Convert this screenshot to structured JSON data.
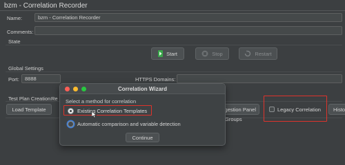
{
  "window": {
    "title": "bzm - Correlation Recorder"
  },
  "form": {
    "name_label": "Name:",
    "name_value": "bzm - Correlation Recorder",
    "comments_label": "Comments:",
    "comments_value": ""
  },
  "state": {
    "label": "State",
    "start_label": "Start",
    "stop_label": "Stop",
    "restart_label": "Restart"
  },
  "global_settings": {
    "label": "Global Settings",
    "port_label": "Port:",
    "port_value": "8888",
    "https_label": "HTTPS Domains:",
    "https_value": ""
  },
  "test_plan": {
    "label": "Test Plan Creation",
    "label_cut": "Re",
    "load_template_label": "Load Template",
    "suggestion_panel_label": "ggestion Panel",
    "legacy_label": "Legacy Correlation",
    "history_label": "Histo",
    "groups_label": "Groups"
  },
  "dialog": {
    "title": "Correlation Wizard",
    "prompt": "Select a method for correlation",
    "options": [
      {
        "label": "Existing Correlation Templates",
        "selected": true
      },
      {
        "label": "Automatic comparison and variable detection",
        "selected": false
      }
    ],
    "continue_label": "Continue",
    "traffic_colors": [
      "#ff5f57",
      "#febc2e",
      "#28c840"
    ]
  },
  "colors": {
    "highlight_box": "#e0332b",
    "start_icon": "#3aa64a",
    "focus_ring": "#3d7dd6"
  }
}
